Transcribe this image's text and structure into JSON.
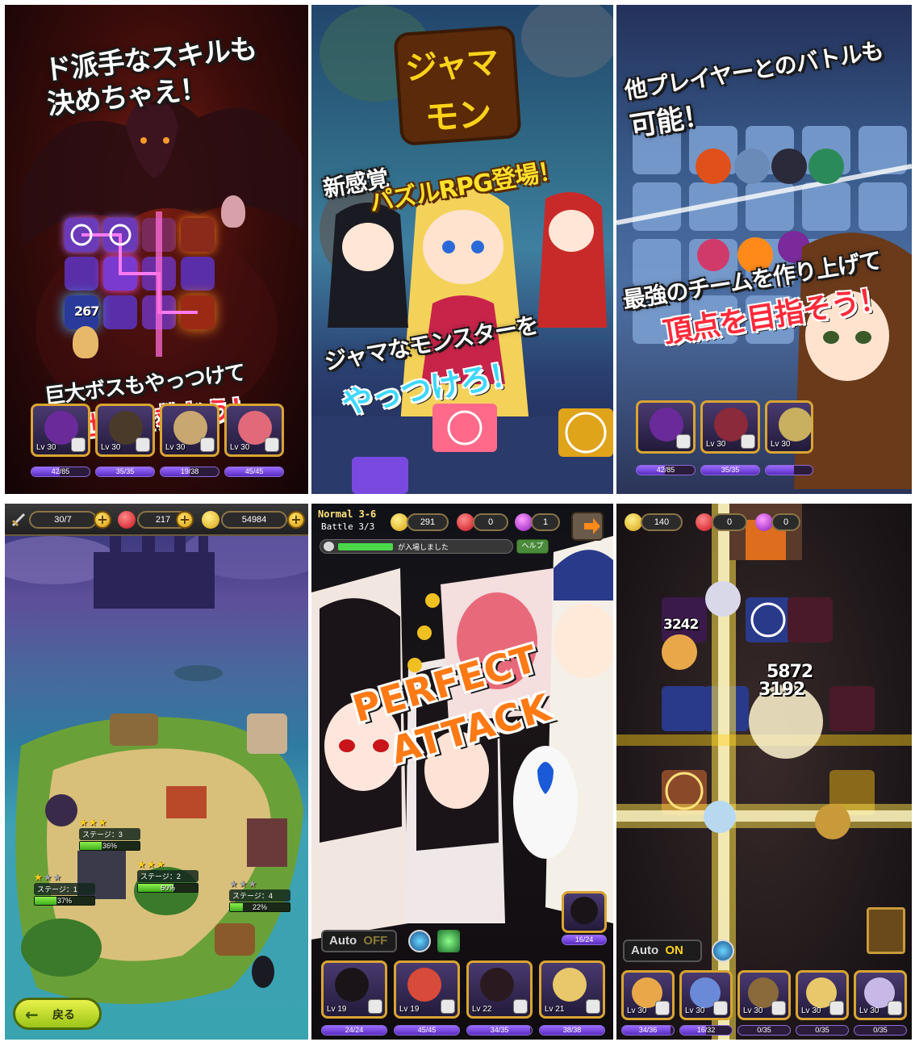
{
  "panel1": {
    "headline_line1": "ド派手なスキルも",
    "headline_line2": "決めちゃえ！",
    "damage_number": "267",
    "bottom_line1": "巨大ボスもやっつけて",
    "bottom_line2": "世界を救おう！",
    "party": [
      {
        "level": "Lv 30",
        "hp": "42/85",
        "hp_fraction": 0.49
      },
      {
        "level": "Lv 30",
        "hp": "35/35",
        "hp_fraction": 1.0
      },
      {
        "level": "Lv 30",
        "hp": "19/38",
        "hp_fraction": 0.5
      },
      {
        "level": "Lv 30",
        "hp": "45/45",
        "hp_fraction": 1.0
      }
    ]
  },
  "panel2": {
    "logo_line1": "ジャマ",
    "logo_line2": "モン",
    "tagline_line1": "新感覚",
    "tagline_line2": "パズルRPG登場！",
    "bottom_line1": "ジャマなモンスターを",
    "bottom_line2": "やっつけろ！"
  },
  "panel3": {
    "headline_line1": "他プレイヤーとのバトルも",
    "headline_line2": "可能！",
    "bottom_line1": "最強のチームを作り上げて",
    "bottom_line2": "頂点を目指そう！",
    "party": [
      {
        "level": "",
        "hp": "42/85",
        "hp_fraction": 0.49
      },
      {
        "level": "Lv 30",
        "hp": "35/35",
        "hp_fraction": 1.0
      },
      {
        "level": "Lv 30",
        "hp": "",
        "hp_fraction": 0.6
      }
    ]
  },
  "panel4": {
    "stamina": "30/7",
    "gems": "217",
    "coins": "54984",
    "back_button": "戻る",
    "stages": [
      {
        "name": "ステージ：3",
        "stars": 3,
        "progress": "36%",
        "progress_fraction": 0.36
      },
      {
        "name": "ステージ：1",
        "stars": 1,
        "progress": "37%",
        "progress_fraction": 0.37
      },
      {
        "name": "ステージ：2",
        "stars": 3,
        "progress": "60%",
        "progress_fraction": 0.6
      },
      {
        "name": "ステージ：4",
        "stars": 0,
        "progress": "22%",
        "progress_fraction": 0.22
      }
    ]
  },
  "panel5": {
    "mode": "Normal 3-6",
    "battle": "Battle 3/3",
    "coins": "291",
    "gems": "0",
    "orbs": "1",
    "chat_message": "が入場しました",
    "help_button": "ヘルプ",
    "perfect_line1": "PERFECT",
    "perfect_line2": "ATTACK",
    "auto_label": "Auto",
    "auto_state": "OFF",
    "skill_counter": "16/24",
    "party": [
      {
        "level": "Lv 19",
        "hp": "24/24",
        "hp_fraction": 1.0
      },
      {
        "level": "Lv 19",
        "hp": "45/45",
        "hp_fraction": 1.0
      },
      {
        "level": "Lv 22",
        "hp": "34/35",
        "hp_fraction": 0.97
      },
      {
        "level": "Lv 21",
        "hp": "38/38",
        "hp_fraction": 1.0
      }
    ]
  },
  "panel6": {
    "coins": "140",
    "gems": "0",
    "orbs": "0",
    "damage_1": "3242",
    "damage_2": "5872",
    "damage_3": "3192",
    "auto_label": "Auto",
    "auto_state": "ON",
    "party": [
      {
        "level": "Lv 30",
        "hp": "34/36",
        "hp_fraction": 0.94
      },
      {
        "level": "Lv 30",
        "hp": "16/32",
        "hp_fraction": 0.5
      },
      {
        "level": "Lv 30",
        "hp": "0/35",
        "hp_fraction": 0.0
      },
      {
        "level": "Lv 30",
        "hp": "0/35",
        "hp_fraction": 0.0
      },
      {
        "level": "Lv 30",
        "hp": "0/35",
        "hp_fraction": 0.0
      }
    ]
  },
  "colors": {
    "headline_white": "#ffffff",
    "headline_yellow": "#ffe02a",
    "headline_red": "#ff2a3a",
    "headline_cyan": "#3ed8ff",
    "hp_purple": "#7a48e0",
    "progress_green": "#5ed02c",
    "perfect_orange": "#ff7a14"
  },
  "icons": [
    "sword-icon",
    "ruby-gem-icon",
    "gold-coin-icon",
    "plus-icon",
    "purple-orb-icon",
    "exit-door-icon",
    "chat-bubble-icon",
    "skill-icon"
  ]
}
